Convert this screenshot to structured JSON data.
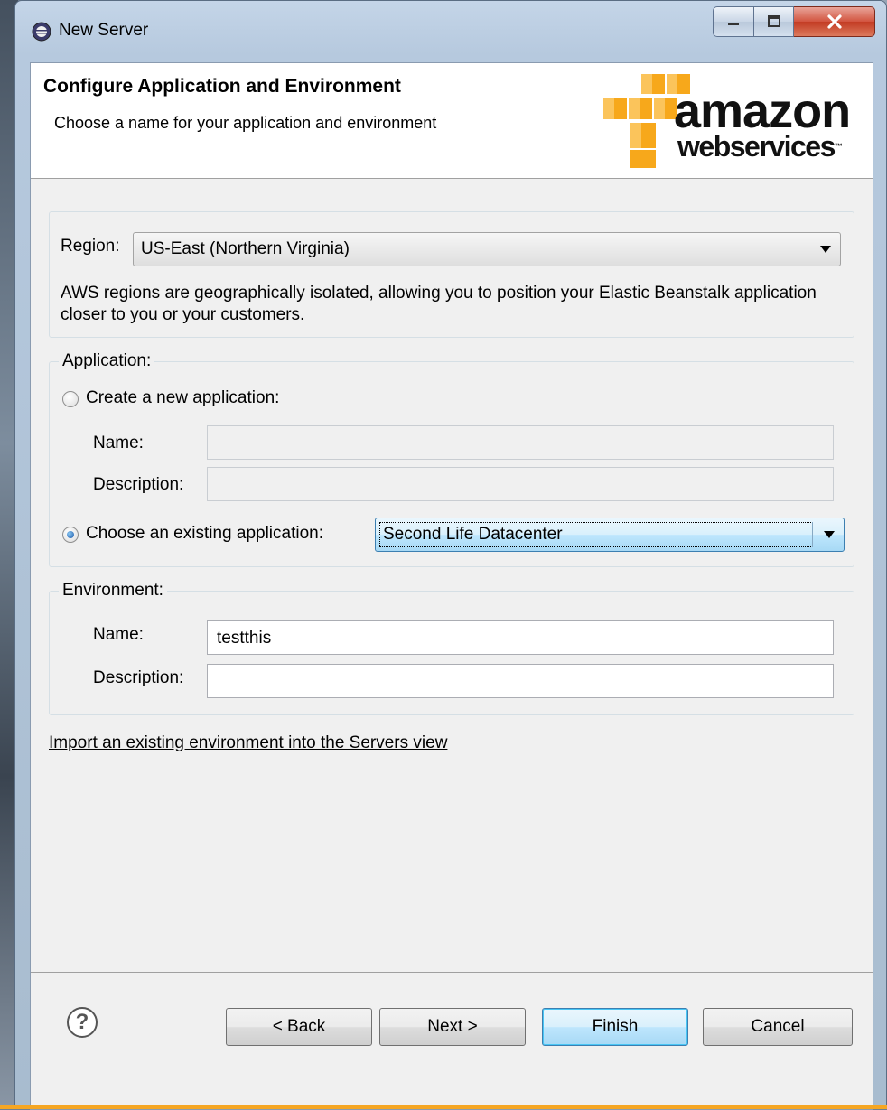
{
  "window": {
    "title": "New Server",
    "minimize_icon": "minimize-icon",
    "maximize_icon": "maximize-icon",
    "close_icon": "close-icon"
  },
  "header": {
    "title": "Configure Application and Environment",
    "subtitle": "Choose a name for your application and environment",
    "logo_line1": "amazon",
    "logo_line2": "webservices",
    "logo_tm": "™"
  },
  "region": {
    "label": "Region:",
    "selected": "US-East (Northern Virginia)",
    "description": "AWS regions are geographically isolated, allowing you to position your Elastic Beanstalk application closer to you or your customers."
  },
  "application": {
    "group_label": "Application:",
    "create_new_label": "Create a new application:",
    "create_new_checked": false,
    "name_label": "Name:",
    "name_value": "",
    "description_label": "Description:",
    "description_value": "",
    "choose_existing_label": "Choose an existing application:",
    "choose_existing_checked": true,
    "existing_selected": "Second Life Datacenter"
  },
  "environment": {
    "group_label": "Environment:",
    "name_label": "Name:",
    "name_value": "testthis",
    "description_label": "Description:",
    "description_value": ""
  },
  "import_link": "Import an existing environment into the Servers view",
  "buttons": {
    "help": "?",
    "back": "< Back",
    "next": "Next >",
    "finish": "Finish",
    "cancel": "Cancel"
  },
  "colors": {
    "aws_orange": "#f7a81b",
    "dialog_bg": "#f0f0f0",
    "accent_blue": "#3c7fb1"
  }
}
